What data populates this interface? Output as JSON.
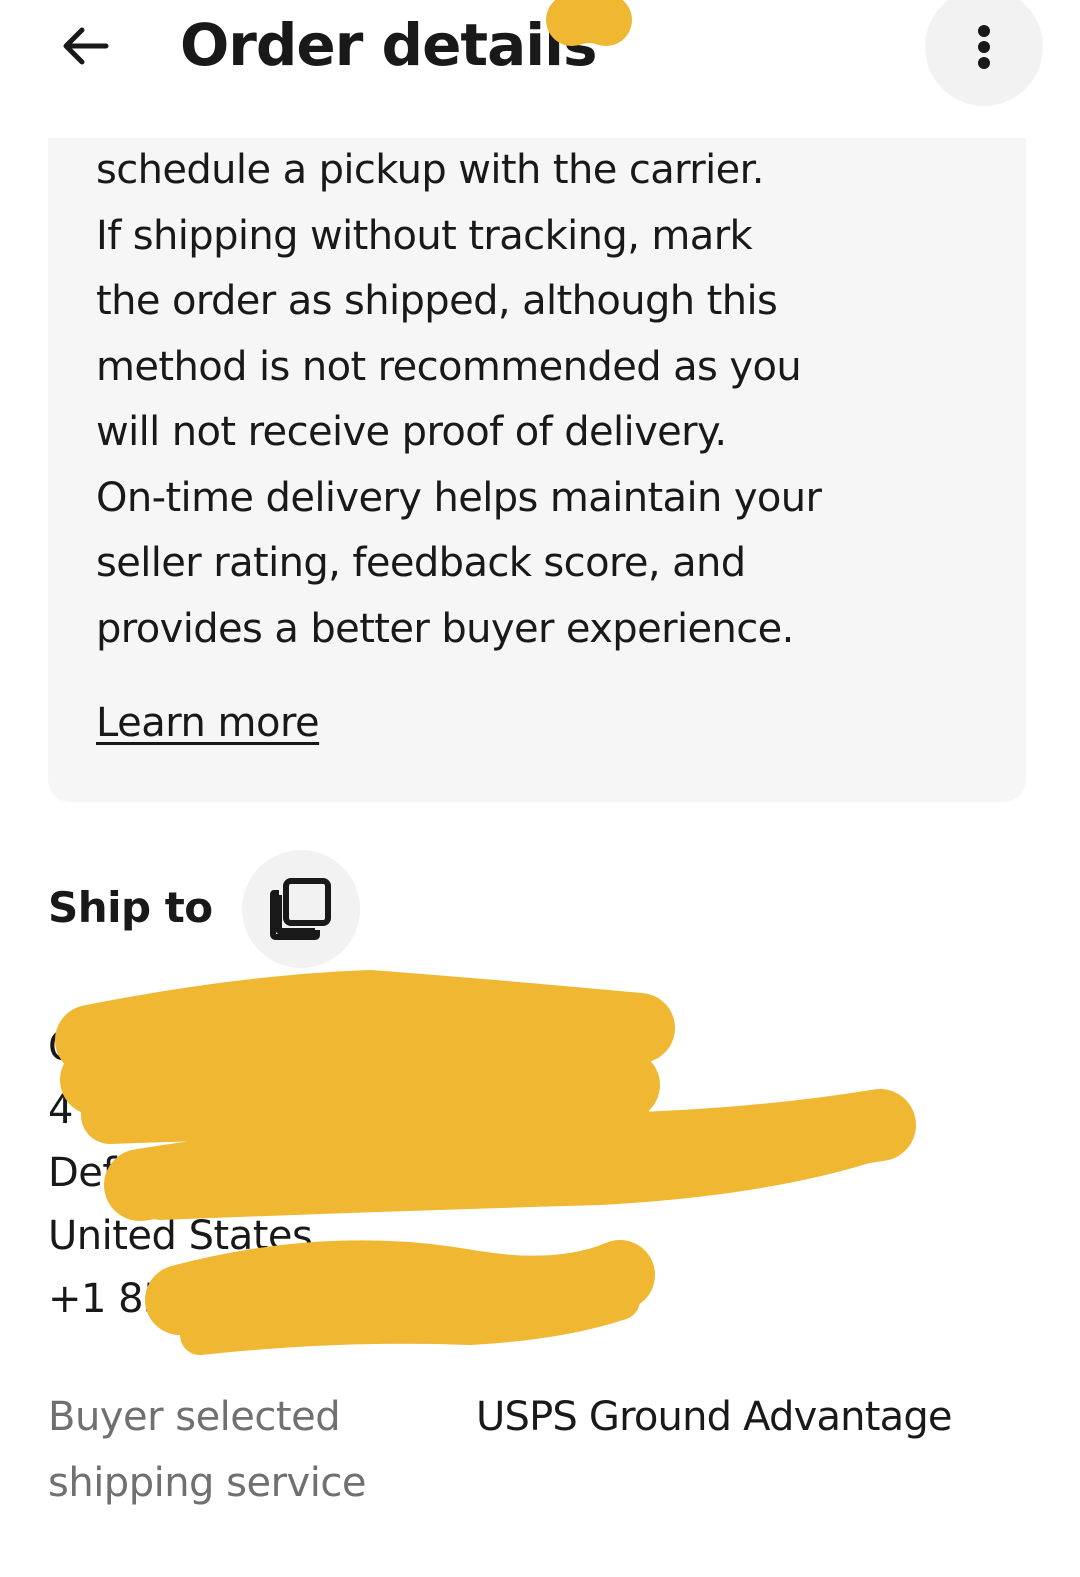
{
  "header": {
    "title": "Order details",
    "back_icon": "arrow-left-icon",
    "more_icon": "more-vertical-icon"
  },
  "info_card": {
    "lines": [
      "schedule a pickup with the carrier.",
      "If shipping without tracking, mark",
      "the order as shipped, although this",
      "method is not recommended as you",
      "will not receive proof of delivery.",
      "On-time delivery helps maintain your",
      "seller rating, feedback score, and",
      "provides a better buyer experience."
    ],
    "learn_more": "Learn more"
  },
  "ship_to": {
    "heading": "Ship to",
    "copy_icon": "copy-icon",
    "address_lines": [
      "G",
      "4",
      "Def",
      "United States",
      "+1 85"
    ]
  },
  "shipping_service": {
    "label": "Buyer selected shipping service",
    "value": "USPS Ground Advantage"
  },
  "colors": {
    "redaction": "#f0b733",
    "card_background": "#f6f6f6",
    "button_background": "#f2f2f2",
    "text_primary": "#191919",
    "text_secondary": "#707070"
  }
}
